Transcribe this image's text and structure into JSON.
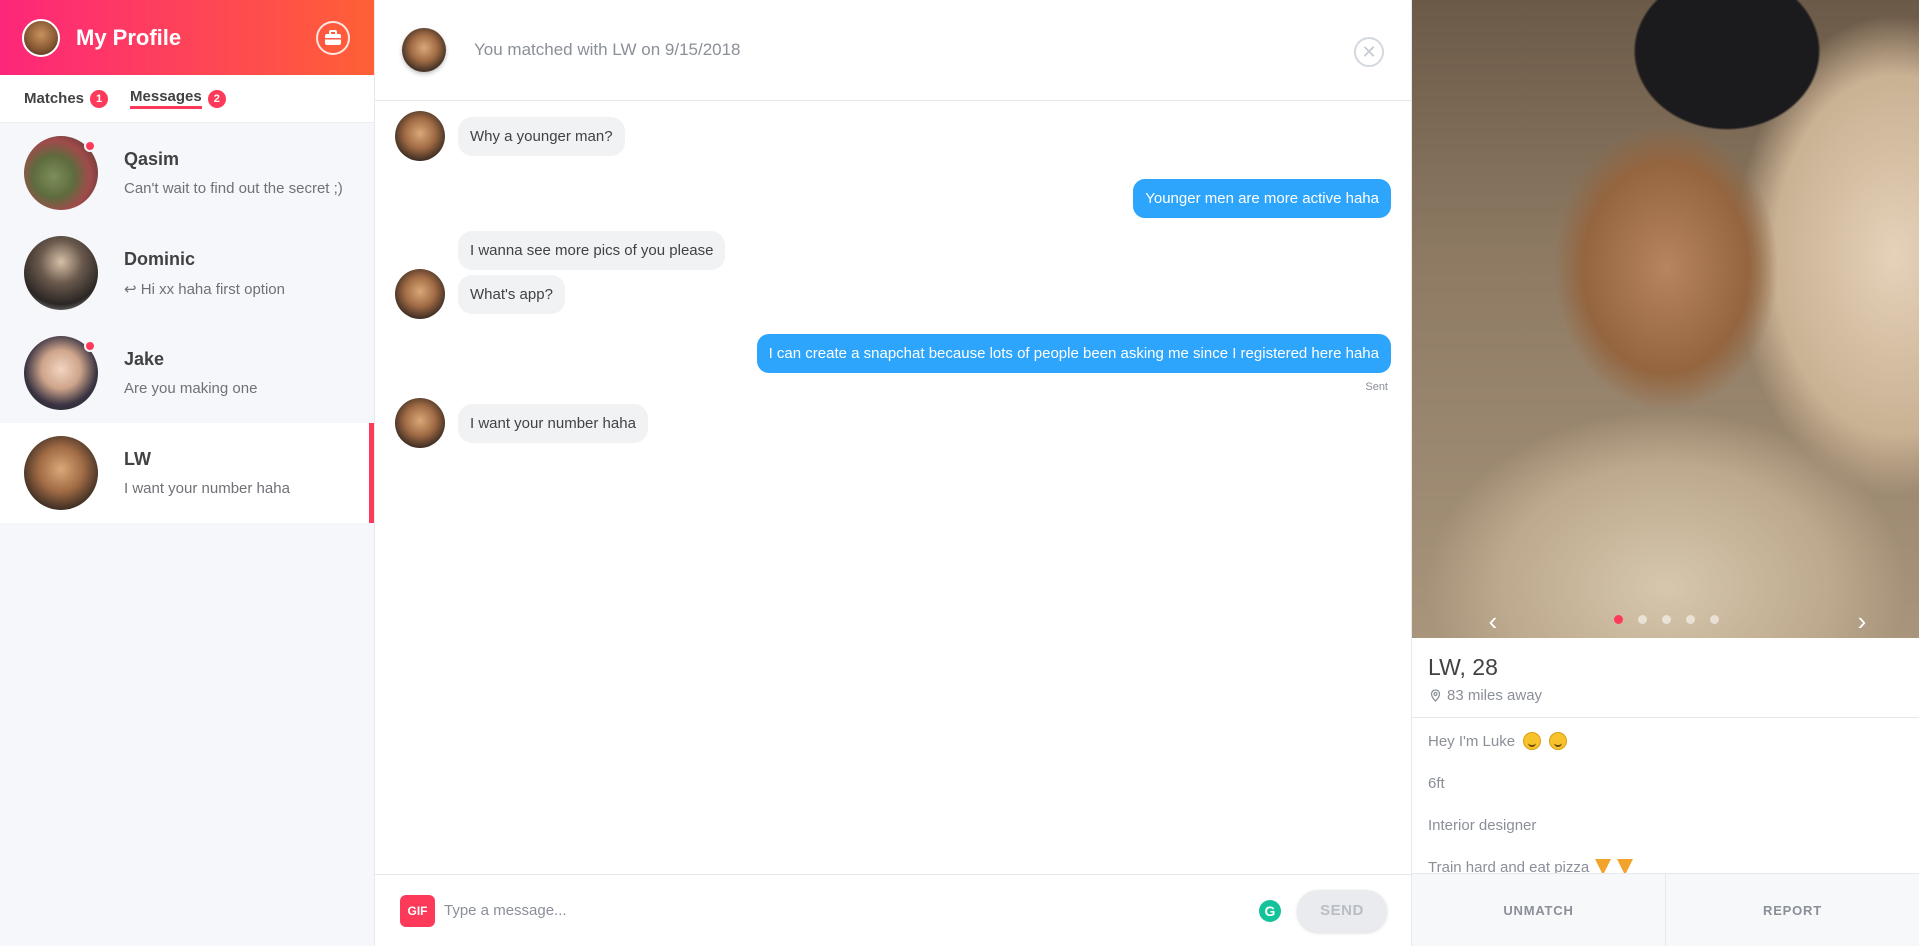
{
  "sidebar": {
    "profile_title": "My Profile",
    "tabs": [
      {
        "label": "Matches",
        "count": "1"
      },
      {
        "label": "Messages",
        "count": "2"
      }
    ],
    "conversations": [
      {
        "name": "Qasim",
        "preview": "Can't wait to find out the secret ;)",
        "unread": true
      },
      {
        "name": "Dominic",
        "preview": "↩ Hi xx haha first option",
        "unread": false
      },
      {
        "name": "Jake",
        "preview": "Are you making one",
        "unread": true
      },
      {
        "name": "LW",
        "preview": "I want your number haha",
        "unread": false,
        "selected": true
      }
    ]
  },
  "chat": {
    "match_info": "You matched with LW on 9/15/2018",
    "messages": [
      {
        "from": "them",
        "text": "Why a younger man?"
      },
      {
        "from": "me",
        "text": "Younger men are more active haha"
      },
      {
        "from": "them",
        "text": "I wanna see more pics of you please"
      },
      {
        "from": "them",
        "text": "What's app?"
      },
      {
        "from": "me",
        "text": "I can create a snapchat because lots of people been asking me since I registered here haha"
      },
      {
        "from": "them",
        "text": "I want your number haha"
      }
    ],
    "sent_label": "Sent",
    "composer": {
      "gif_label": "GIF",
      "placeholder": "Type a message...",
      "grammarly_label": "G",
      "send_label": "SEND"
    }
  },
  "profile": {
    "name_age": "LW, 28",
    "distance": "83 miles away",
    "photo_count": 5,
    "active_photo": 1,
    "bio": [
      "Hey I'm Luke",
      "6ft",
      "Interior designer",
      "Train hard and eat pizza"
    ],
    "unmatch_label": "UNMATCH",
    "report_label": "REPORT"
  },
  "colors": {
    "brand_gradient_start": "#fd267a",
    "brand_gradient_end": "#ff6036",
    "accent": "#fd3a5a",
    "outgoing_bubble": "#2da5fd",
    "incoming_bubble": "#f0f2f4"
  },
  "icons": [
    "briefcase-icon",
    "close-icon",
    "location-pin-icon",
    "chevron-left-icon",
    "chevron-right-icon",
    "grammarly-icon"
  ]
}
